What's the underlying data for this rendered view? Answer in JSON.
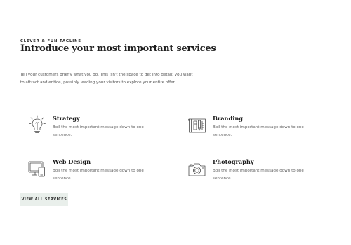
{
  "header": {
    "tagline": "CLEVER & FUN TAGLINE",
    "title": "Introduce your most important services",
    "intro": "Tell your customers briefly what you do. This isn't the space to get into detail; you want to attract and entice, possibly leading your visitors to explore your entire offer."
  },
  "services": [
    {
      "name": "Strategy",
      "desc": "Boil the most important message down to one sentence.",
      "icon": "lightbulb-icon"
    },
    {
      "name": "Branding",
      "desc": "Boil the most important message down to one sentence.",
      "icon": "blueprint-icon"
    },
    {
      "name": "Web Design",
      "desc": "Boil the most important message down to one sentence.",
      "icon": "devices-icon"
    },
    {
      "name": "Photography",
      "desc": "Boil the most important message down to one sentence.",
      "icon": "camera-icon"
    }
  ],
  "cta": {
    "label": "VIEW ALL SERVICES"
  },
  "colors": {
    "button_bg": "#e9efeb",
    "text": "#2b2b2b",
    "icon_stroke": "#4a4a4a"
  }
}
